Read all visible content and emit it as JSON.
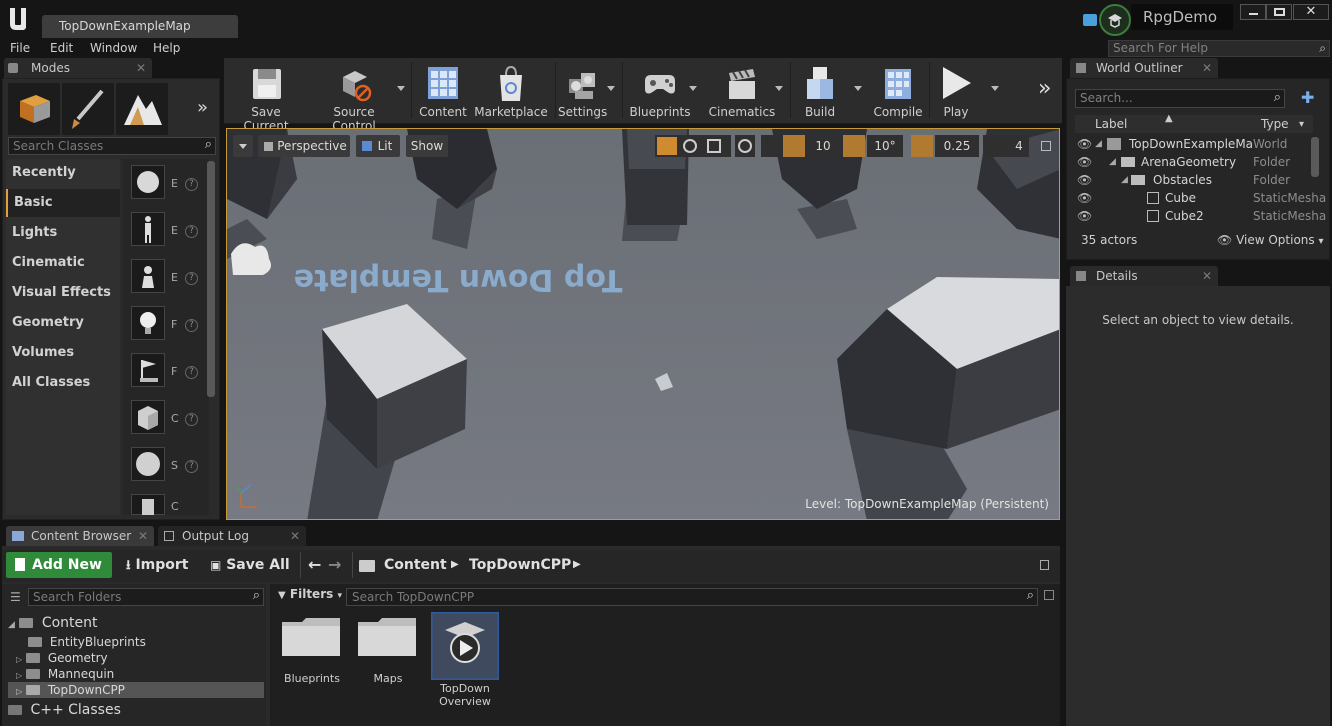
{
  "window": {
    "map_tab": "TopDownExampleMap",
    "project_name": "RpgDemo"
  },
  "menu": [
    "File",
    "Edit",
    "Window",
    "Help"
  ],
  "help_search_placeholder": "Search For Help",
  "modes": {
    "tab_label": "Modes",
    "search_placeholder": "Search Classes",
    "categories": [
      "Recently Placed",
      "Basic",
      "Lights",
      "Cinematic",
      "Visual Effects",
      "Geometry",
      "Volumes",
      "All Classes"
    ],
    "active_category": "Basic",
    "item_letters": [
      "E",
      "E",
      "E",
      "F",
      "F",
      "C",
      "S",
      "C"
    ]
  },
  "toolbar": {
    "save_current": "Save Current",
    "source_control": "Source Control",
    "content": "Content",
    "marketplace": "Marketplace",
    "settings": "Settings",
    "blueprints": "Blueprints",
    "cinematics": "Cinematics",
    "build": "Build",
    "compile": "Compile",
    "play": "Play"
  },
  "viewport": {
    "perspective": "Perspective",
    "lit": "Lit",
    "show": "Show",
    "grid_snap": "10",
    "rotation_snap": "10°",
    "scale_snap": "0.25",
    "camera_speed": "4",
    "floor_text": "Top Down Template",
    "level_prefix": "Level:",
    "level_name": "TopDownExampleMap (Persistent)"
  },
  "outliner": {
    "tab_label": "World Outliner",
    "search_placeholder": "Search...",
    "col_label": "Label",
    "col_type": "Type",
    "rows": [
      {
        "label": "TopDownExampleMa",
        "type": "World"
      },
      {
        "label": "ArenaGeometry",
        "type": "Folder"
      },
      {
        "label": "Obstacles",
        "type": "Folder"
      },
      {
        "label": "Cube",
        "type": "StaticMesha"
      },
      {
        "label": "Cube2",
        "type": "StaticMesha"
      }
    ],
    "actor_count": "35 actors",
    "view_options": "View Options"
  },
  "details": {
    "tab_label": "Details",
    "empty_text": "Select an object to view details."
  },
  "content_browser": {
    "tab_label": "Content Browser",
    "output_tab_label": "Output Log",
    "add_new": "Add New",
    "import": "Import",
    "save_all": "Save All",
    "breadcrumb": [
      "Content",
      "TopDownCPP"
    ],
    "folder_search_placeholder": "Search Folders",
    "filters": "Filters",
    "asset_search_placeholder": "Search TopDownCPP",
    "tree": {
      "root": "Content",
      "children": [
        "EntityBlueprints",
        "Geometry",
        "Mannequin",
        "TopDownCPP"
      ],
      "selected": "TopDownCPP",
      "cpp": "C++ Classes"
    },
    "assets": [
      "Blueprints",
      "Maps",
      "TopDown Overview"
    ]
  }
}
